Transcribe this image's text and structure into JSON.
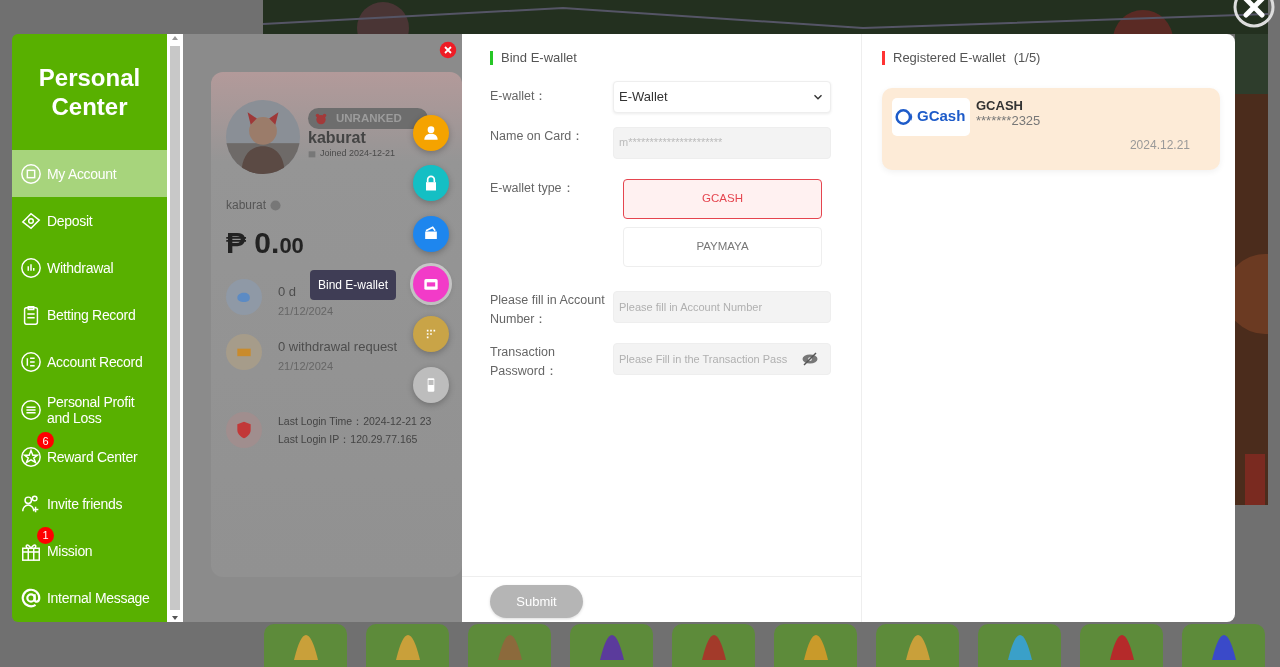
{
  "sidebar": {
    "title": "Personal Center",
    "items": [
      {
        "label": "My Account",
        "selected": true
      },
      {
        "label": "Deposit",
        "selected": false
      },
      {
        "label": "Withdrawal",
        "selected": false
      },
      {
        "label": "Betting Record",
        "selected": false
      },
      {
        "label": "Account Record",
        "selected": false
      },
      {
        "label": "Personal Profit and Loss",
        "selected": false
      },
      {
        "label": "Reward Center",
        "badge": "6",
        "selected": false
      },
      {
        "label": "Invite friends",
        "selected": false
      },
      {
        "label": "Mission",
        "badge": "1",
        "selected": false
      },
      {
        "label": "Internal Message",
        "selected": false
      }
    ]
  },
  "account_card": {
    "rank": "UNRANKED",
    "username": "kaburat",
    "joined": "Joined 2024-12-21",
    "account_name": "kaburat",
    "currency": "₱",
    "balance_main": "0.",
    "balance_cents": "00",
    "notices": [
      {
        "text": "0 d",
        "date": "21/12/2024"
      },
      {
        "text": "0 withdrawal request",
        "date": "21/12/2024"
      }
    ],
    "login_time_label": "Last Login Time：",
    "login_time": "2024-12-21 23",
    "login_ip_label": "Last Login IP：",
    "login_ip": "120.29.77.165"
  },
  "quick_menu": {
    "tooltip": "Bind E-wallet",
    "items": [
      {
        "color": "#f5a300",
        "selected": false
      },
      {
        "color": "#14bfc4",
        "selected": false
      },
      {
        "color": "#1e86ee",
        "selected": false
      },
      {
        "color": "#f23bc8",
        "selected": true
      },
      {
        "color": "#c9a447",
        "selected": false
      },
      {
        "color": "#bdbdbd",
        "selected": false
      }
    ]
  },
  "bind_form": {
    "title": "Bind E-wallet",
    "ewallet_label": "E-wallet：",
    "ewallet_value": "E-Wallet",
    "name_label": "Name on Card：",
    "name_value": "m**********************",
    "type_label": "E-wallet type：",
    "types": [
      {
        "label": "GCASH",
        "selected": true
      },
      {
        "label": "PAYMAYA",
        "selected": false
      }
    ],
    "account_label": "Please fill in Account Number：",
    "account_placeholder": "Please fill in Account Number",
    "password_label": "Transaction Password：",
    "password_placeholder": "Please Fill in the Transaction Pass",
    "submit": {
      "label": "Submit",
      "disabled": true
    }
  },
  "registered": {
    "title": "Registered E-wallet",
    "count": "(1/5)",
    "wallets": [
      {
        "logo_text": "GCash",
        "name": "GCASH",
        "number": "*******2325",
        "date": "2024.12.21"
      }
    ]
  }
}
